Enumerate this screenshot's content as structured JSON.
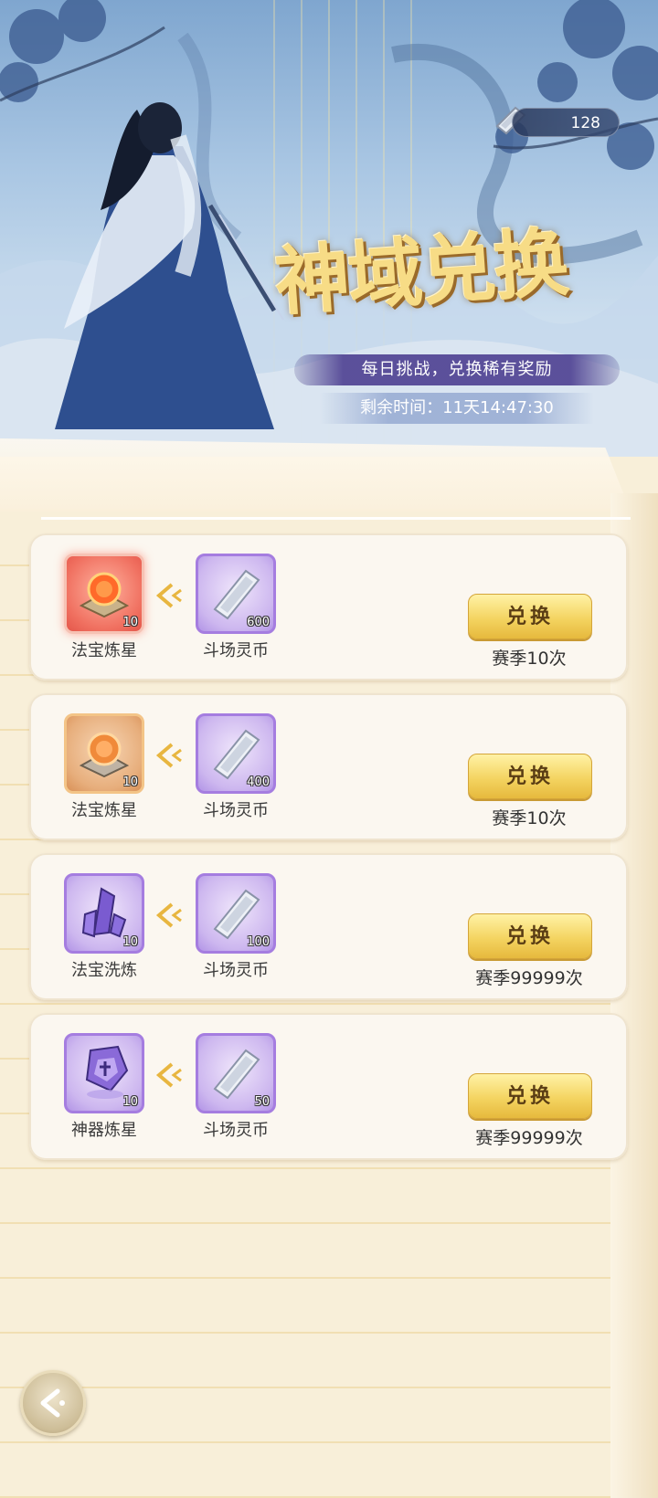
{
  "header": {
    "currency_value": "128",
    "currency_icon": "silver-ingot-icon",
    "title": "神域兑换",
    "subtitle": "每日挑战，兑换稀有奖励",
    "timer": "剩余时间：11天14:47:30"
  },
  "exchanges": [
    {
      "target": {
        "name": "法宝炼星",
        "qty": "10",
        "rarity": "red",
        "icon": "treasure-star-refine-icon"
      },
      "cost": {
        "name": "斗场灵币",
        "qty": "600",
        "icon": "arena-coin-icon"
      },
      "button_label": "兑换",
      "limit": "赛季10次"
    },
    {
      "target": {
        "name": "法宝炼星",
        "qty": "10",
        "rarity": "orange",
        "icon": "treasure-star-refine-icon"
      },
      "cost": {
        "name": "斗场灵币",
        "qty": "400",
        "icon": "arena-coin-icon"
      },
      "button_label": "兑换",
      "limit": "赛季10次"
    },
    {
      "target": {
        "name": "法宝洗炼",
        "qty": "10",
        "rarity": "purple",
        "icon": "purple-crystal-icon"
      },
      "cost": {
        "name": "斗场灵币",
        "qty": "100",
        "icon": "arena-coin-icon"
      },
      "button_label": "兑换",
      "limit": "赛季99999次"
    },
    {
      "target": {
        "name": "神器炼星",
        "qty": "10",
        "rarity": "purple",
        "icon": "artifact-star-refine-icon"
      },
      "cost": {
        "name": "斗场灵币",
        "qty": "50",
        "icon": "arena-coin-icon"
      },
      "button_label": "兑换",
      "limit": "赛季99999次"
    }
  ],
  "colors": {
    "gold_button": "#f4d461",
    "panel": "#f8efd9",
    "subtitle_bar": "#5448a0",
    "rarity_red": "#f07060",
    "rarity_orange": "#e7ae7c",
    "rarity_purple": "#b294e6"
  }
}
